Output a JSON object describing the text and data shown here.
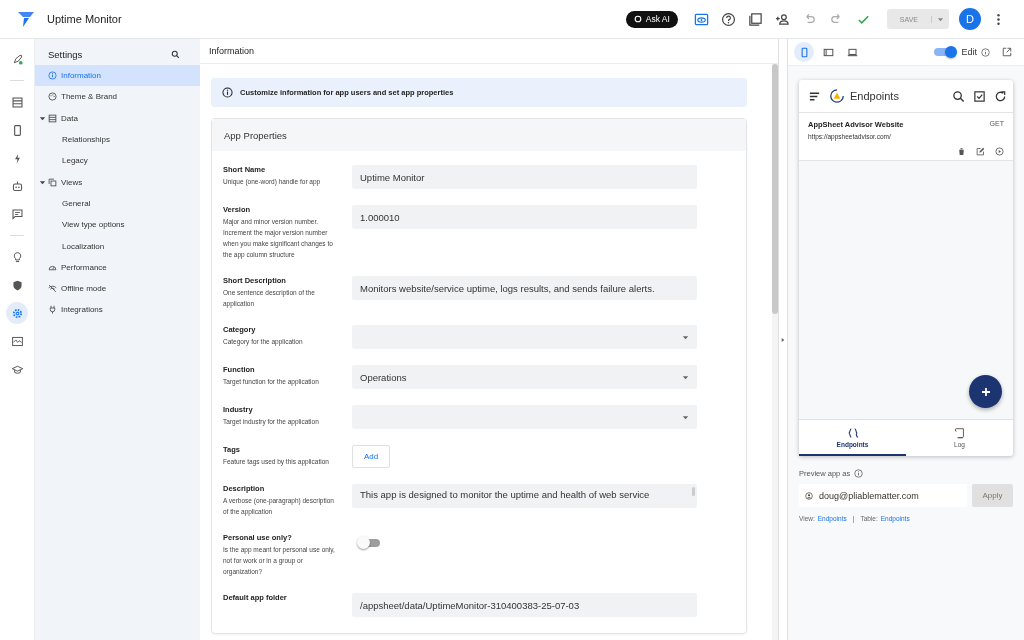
{
  "topbar": {
    "app_title": "Uptime Monitor",
    "ask_ai": "Ask AI",
    "save": {
      "label": "SAVE",
      "disabled": true
    },
    "avatar": "D"
  },
  "rail": [
    {
      "selected": false
    },
    {
      "selected": false
    },
    {
      "selected": false
    },
    {
      "selected": false
    },
    {
      "selected": false
    },
    {
      "selected": false
    },
    {
      "selected": false
    },
    {
      "selected": false
    },
    {
      "selected": true
    },
    {
      "selected": false
    },
    {
      "selected": false
    }
  ],
  "sidebar": {
    "title": "Settings",
    "items": [
      {
        "label": "Information",
        "selected": true
      },
      {
        "label": "Theme & Brand",
        "selected": false
      },
      {
        "label": "Data",
        "selected": false,
        "expanded": true,
        "children": [
          {
            "label": "Relationships",
            "selected": false
          },
          {
            "label": "Legacy",
            "selected": false
          }
        ]
      },
      {
        "label": "Views",
        "selected": false,
        "expanded": true,
        "children": [
          {
            "label": "General",
            "selected": false
          },
          {
            "label": "View type options",
            "selected": false
          },
          {
            "label": "Localization",
            "selected": false
          }
        ]
      },
      {
        "label": "Performance",
        "selected": false
      },
      {
        "label": "Offline mode",
        "selected": false
      },
      {
        "label": "Integrations",
        "selected": false
      }
    ]
  },
  "main": {
    "title": "Information",
    "banner": "Customize information for app users and set app properties",
    "card_title": "App Properties",
    "fields": [
      {
        "kind": "text",
        "label": "Short Name",
        "hint": "Unique (one-word) handle for app",
        "value": "Uptime Monitor"
      },
      {
        "kind": "text",
        "label": "Version",
        "hint": "Major and minor version number. Increment the major version number when you make significant changes to the app column structure",
        "value": "1.000010"
      },
      {
        "kind": "text",
        "label": "Short Description",
        "hint": "One sentence description of the application",
        "value": "Monitors website/service uptime, logs results, and sends failure alerts."
      },
      {
        "kind": "select",
        "label": "Category",
        "hint": "Category for the application"
      },
      {
        "kind": "select",
        "label": "Function",
        "hint": "Target function for the application",
        "value": "Operations"
      },
      {
        "kind": "select",
        "label": "Industry",
        "hint": "Target industry for the application"
      },
      {
        "kind": "button",
        "label": "Tags",
        "hint": "Feature tags used by this application",
        "value": "Add"
      },
      {
        "kind": "textarea",
        "label": "Description",
        "hint": "A verbose (one-paragraph) description of the application",
        "value": "This app is designed to monitor the uptime and health of web service"
      },
      {
        "kind": "toggle",
        "label": "Personal use only?",
        "hint": "Is the app meant for personal use only, not for work or in a group or organization?",
        "on": false
      },
      {
        "kind": "text",
        "label": "Default app folder",
        "value": "/appsheet/data/UptimeMonitor-310400383-25-07-03"
      }
    ]
  },
  "preview": {
    "devices": [
      {
        "selected": true
      },
      {
        "selected": false
      },
      {
        "selected": false
      }
    ],
    "edit": {
      "label": "Edit",
      "on": true
    },
    "phone": {
      "title": "Endpoints",
      "rows": [
        {
          "title": "AppSheet Advisor Website",
          "url": "https://appsheetadvisor.com/",
          "method": "GET"
        }
      ],
      "nav": [
        {
          "label": "Endpoints",
          "selected": true
        },
        {
          "label": "Log",
          "selected": false
        }
      ]
    },
    "preview_as": {
      "label": "Preview app as",
      "email": "doug@pliablematter.com",
      "apply": {
        "label": "Apply",
        "disabled": true
      }
    },
    "footer": {
      "view_label": "View:",
      "view": "Endpoints",
      "sep": "|",
      "table_label": "Table:",
      "table": "Endpoints"
    }
  }
}
